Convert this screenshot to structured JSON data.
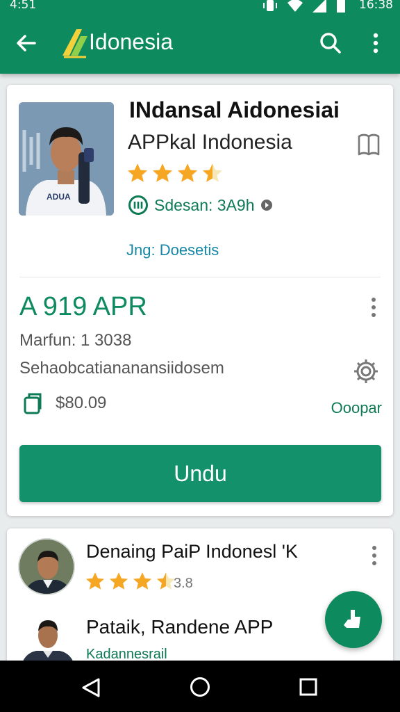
{
  "status": {
    "time_left": "4:51",
    "time_right": "16:38"
  },
  "appbar": {
    "title": "Idonesia"
  },
  "card1": {
    "app_name": "INdansal Aidonesiai",
    "developer": "APPkal Indonesia",
    "rating": 3.5,
    "badge_text": "Sdesan: 3A9h",
    "tag": "Jng: Doesetis",
    "price_main": "A 919 APR",
    "info_line1": "Marfun: 1 3038",
    "info_line2": "Sehaobcatiananansiidosem",
    "price_secondary": "$80.09",
    "link_right": "Ooopar",
    "button_label": "Undu"
  },
  "card2": {
    "title": "Denaing PaiP  Indonesl 'K",
    "rating": 3.5,
    "rating_text": "3.8",
    "subtitle": "Pataik, Randene APP",
    "subtitle2": "Kadannesrail"
  },
  "colors": {
    "primary": "#0e8a5f",
    "button": "#12916a",
    "star": "#f5a623"
  }
}
